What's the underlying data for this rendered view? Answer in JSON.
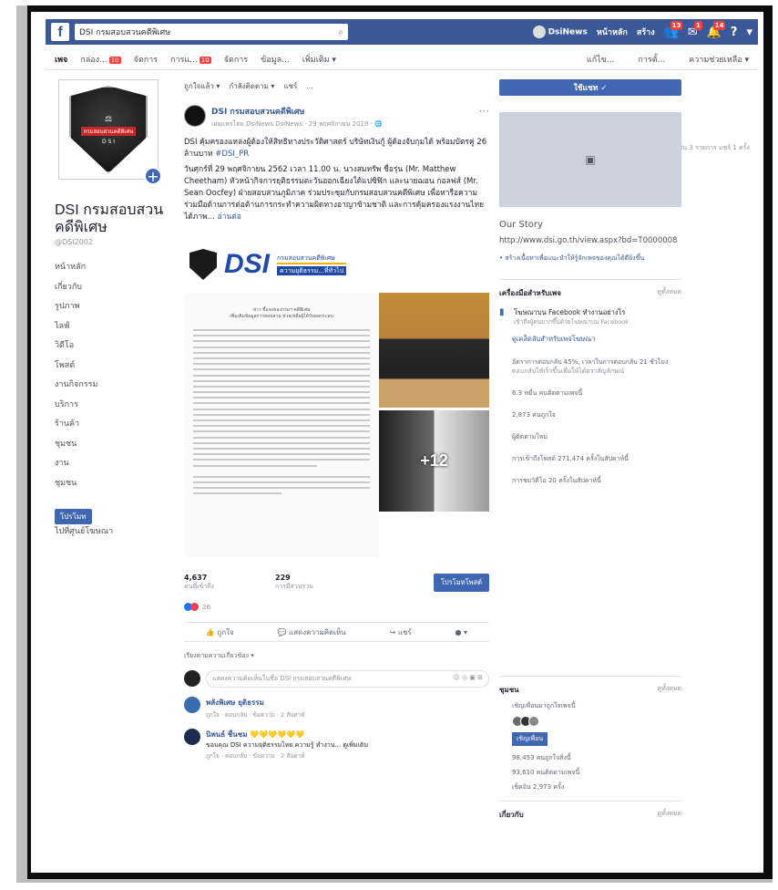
{
  "topbar": {
    "search_placeholder": "DSI กรมสอบสวนคดีพิเศษ",
    "user_label": "DsiNews",
    "home_label": "หน้าหลัก",
    "create_label": "สร้าง",
    "badge_friends": "13",
    "badge_messages": "1",
    "badge_notifications": "14"
  },
  "pagenav": {
    "items": [
      {
        "label": "เพจ",
        "badge": ""
      },
      {
        "label": "กล่อง...",
        "badge": "10"
      },
      {
        "label": "จัดการ",
        "badge": ""
      },
      {
        "label": "การแ...",
        "badge": "10"
      },
      {
        "label": "จัดการ",
        "badge": ""
      },
      {
        "label": "ข้อมูล...",
        "badge": ""
      },
      {
        "label": "เพิ่มเติม ▾",
        "badge": ""
      }
    ],
    "right": [
      "แก้ไข...",
      "การตั้...",
      "ความช่วยเหลือ ▾"
    ]
  },
  "page": {
    "name": "DSI กรมสอบสวนคดีพิเศษ",
    "handle": "@DSI2002",
    "logo_text_top": "กรมสอบสวนคดีพิเศษ",
    "logo_text_bottom": "D S I"
  },
  "leftnav": [
    "หน้าหลัก",
    "เกี่ยวกับ",
    "รูปภาพ",
    "ไลฟ์",
    "วิดีโอ",
    "โพสต์",
    "งานกิจกรรม",
    "บริการ",
    "ร้านค้า",
    "ชุมชน",
    "งาน",
    "ชุมชน"
  ],
  "left_buttons": {
    "promote": "โปรโมท",
    "visit": "ไปที่ศูนย์โฆษณา"
  },
  "composer": [
    "ถูกใจแล้ว ▾",
    "กำลังติดตาม ▾",
    "แชร์",
    "..."
  ],
  "post": {
    "author": "DSI กรมสอบสวนคดีพิเศษ",
    "meta": "เผยแพร่โดย DsiNews DsiNews · 29 พฤศจิกายน 2019 · 🌐",
    "text1": "DSI คุ้มครองแหล่งผู้ต้องให้สิทธิทางประวัติศาสตร์ บริษัทเงินกู้ ผู้ต้องจับกุมได้ พร้อมบัตรคู่ 26 ล้านบาท",
    "hashtag": "#DSI_PR",
    "text2": "วันศุกร์ที่ 29 พฤศจิกายน 2562 เวลา 11.00 น. นางสมทรัพ ชื่อรุ่น (Mr. Matthew Cheetham) หัวหน้ากิจการยุติธรรมตะวันออกเฉียงใต้แปซิฟิก และนายฌอน กอลฟส์ (Mr. Sean Oocfey) ฝ่ายสอบสวนภูมิภาค ร่วมประชุมกับกรมสอบสวนคดีพิเศษ เพื่อหารือความร่วมมือด้านการต่อต้านการกระทำความผิดทางอาญาข้ามชาติ และการคุ้มครองแรงงานไทย ได้ภาพ...",
    "readmore": "อ่านต่อ",
    "banner_word": "DSI",
    "banner_line1": "กรมสอบสวนคดีพิเศษ",
    "banner_line2": "ความยุติธรรม...ที่ทั่วไป",
    "doc_head": "ข่าว ชี้แจงของกรมฯ คดีพิเศษ\nเพิ่มเติมข้อมูลการสอบสวน ช่วยเหลือผู้ได้รับผลกระทบ",
    "photo_more": "+12",
    "reach_value": "4,637",
    "reach_label": "คนที่เข้าถึง",
    "engage_value": "229",
    "engage_label": "การมีส่วนร่วม",
    "boost_label": "โปรโมทโพสต์",
    "reaction_count": "26",
    "reactions_right": "ความคิดเห็น 3 รายการ  แชร์ 1 ครั้ง",
    "action_like": "ถูกใจ",
    "action_comment": "แสดงความคิดเห็น",
    "action_share": "แชร์",
    "sort_label": "เรียงตามความเกี่ยวข้อง ▾",
    "comment_placeholder": "แสดงความคิดเห็นในชื่อ DSI กรมสอบสวนคดีพิเศษ",
    "comments": [
      {
        "name": "พลังพิเศษ ยุติธรรม",
        "text": "ความยุติธรรม",
        "meta": "ถูกใจ · ตอบกลับ · ข้อความ · 2 สัปดาห์"
      },
      {
        "name": "นิพนธ์ ชื่นชม 💛💛💛💛💛💛",
        "text": "ขอบคุณ DSI ความยุติธรรมไทย ความรู้ ทำงาน... ดูเพิ่มเติม",
        "meta": "ถูกใจ · ตอบกลับ · ข้อความ · 2 สัปดาห์"
      }
    ]
  },
  "right": {
    "like_button": "ใช้แชท ✓",
    "cover_icon": "image-icon",
    "story_title": "Our Story",
    "story_url": "http://www.dsi.go.th/view.aspx?bd=T0000008",
    "story_desc": "• สร้างเนื้อหาเพื่อแนะนำให้รู้จักเพจของคุณได้ดียิ่งขึ้น",
    "tools_title": "เครื่องมือสำหรับเพจ",
    "tools_more": "ดูทั้งหมด",
    "tip_title": "โฆษณาบน Facebook ทำงานอย่างไร",
    "tip_sub": "เข้าถึงผู้คนมากขึ้นด้วยโฆษณาบน Facebook",
    "tip_link": "ดูเคล็ดลับสำหรับเพจโฆษณา",
    "stat1": "อัตราการตอบกลับ 45%, เวลาในการตอบกลับ 21 ชั่วโมง",
    "stat1_sub": "ตอบกลับให้เร็วขึ้นเพื่อให้ได้ตราสัญลักษณ์",
    "stat2": "6.3 หมื่น คนติดตามเพจนี้",
    "stat3": "2,873 คนถูกใจ",
    "stat4": "ผู้ติดตามใหม่",
    "stat5": "การเข้าถึงโพสต์ 271,474 ครั้งในสัปดาห์นี้",
    "stat6": "การชมวิดีโอ 20 ครั้งในสัปดาห์นี้",
    "community_title": "ชุมชน",
    "community_more": "ดูทั้งหมด",
    "community_desc": "เชิญเพื่อนมาถูกใจเพจนี้",
    "invite": "เชิญเพื่อน",
    "likes_total": "98,453 คนถูกใจสิ่งนี้",
    "follows_total": "93,610 คนติดตามเพจนี้",
    "checkins": "เช็คอิน 2,973 ครั้ง",
    "bottom_left": "เกี่ยวกับ",
    "bottom_right": "ดูทั้งหมด"
  }
}
